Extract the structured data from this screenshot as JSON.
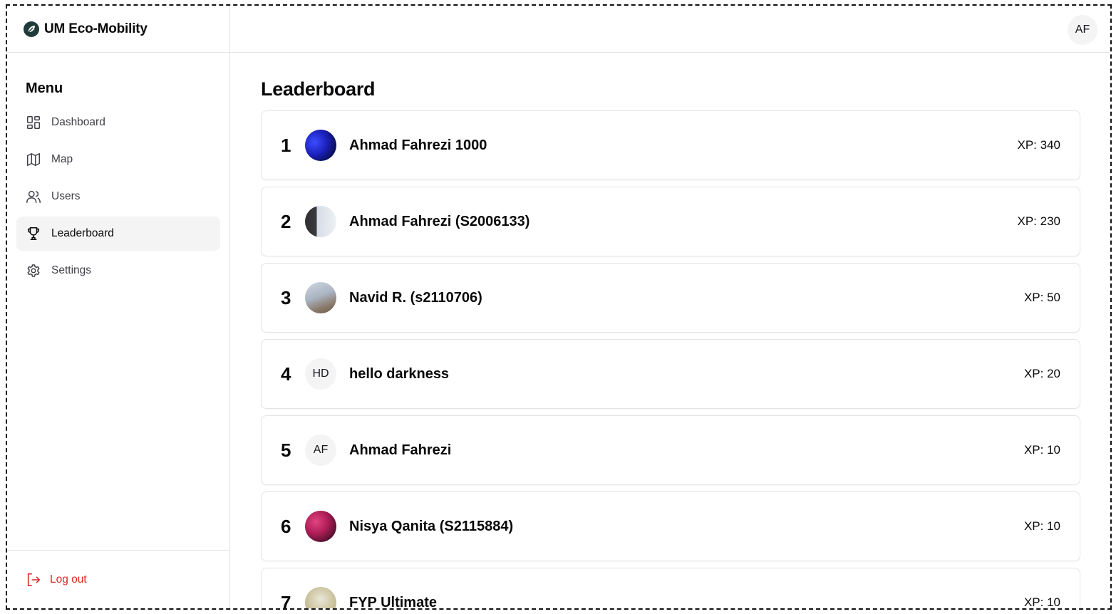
{
  "app": {
    "name": "UM Eco-Mobility"
  },
  "header": {
    "user_initials": "AF"
  },
  "sidebar": {
    "menu_title": "Menu",
    "items": [
      {
        "label": "Dashboard",
        "icon": "layout-grid-icon",
        "active": false
      },
      {
        "label": "Map",
        "icon": "map-icon",
        "active": false
      },
      {
        "label": "Users",
        "icon": "users-icon",
        "active": false
      },
      {
        "label": "Leaderboard",
        "icon": "trophy-icon",
        "active": true
      },
      {
        "label": "Settings",
        "icon": "gear-icon",
        "active": false
      }
    ],
    "logout_label": "Log out"
  },
  "main": {
    "title": "Leaderboard",
    "entries": [
      {
        "rank": "1",
        "name": "Ahmad Fahrezi 1000",
        "xp": "XP: 340",
        "avatar": "photo",
        "initials": ""
      },
      {
        "rank": "2",
        "name": "Ahmad Fahrezi (S2006133)",
        "xp": "XP: 230",
        "avatar": "photo",
        "initials": ""
      },
      {
        "rank": "3",
        "name": "Navid R. (s2110706)",
        "xp": "XP: 50",
        "avatar": "photo",
        "initials": ""
      },
      {
        "rank": "4",
        "name": "hello darkness",
        "xp": "XP: 20",
        "avatar": "initials",
        "initials": "HD"
      },
      {
        "rank": "5",
        "name": "Ahmad Fahrezi",
        "xp": "XP: 10",
        "avatar": "initials",
        "initials": "AF"
      },
      {
        "rank": "6",
        "name": "Nisya Qanita (S2115884)",
        "xp": "XP: 10",
        "avatar": "photo",
        "initials": ""
      },
      {
        "rank": "7",
        "name": "FYP Ultimate",
        "xp": "XP: 10",
        "avatar": "photo",
        "initials": ""
      }
    ]
  },
  "colors": {
    "accent_dark": "#1f3b3a",
    "logout": "#dc2626",
    "active_bg": "#f4f4f5",
    "border": "#e4e4e7"
  }
}
